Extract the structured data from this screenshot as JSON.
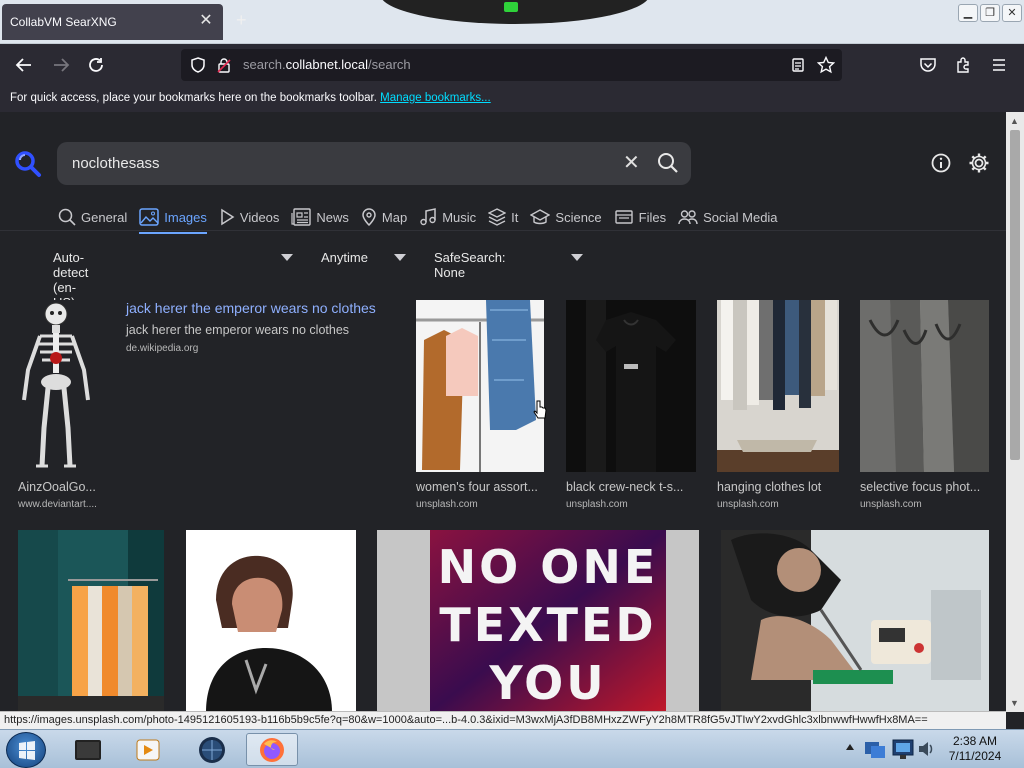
{
  "browser": {
    "tab_title": "CollabVM SearXNG",
    "tab_close_icon": "close-icon",
    "new_tab_label": "+",
    "url_prefix": "search.",
    "url_host": "collabnet.local",
    "url_path": "/search",
    "bookmarks_prompt": "For quick access, place your bookmarks here on the bookmarks toolbar.",
    "bookmarks_link": "Manage bookmarks..."
  },
  "search": {
    "query": "noclothesass"
  },
  "categories": [
    {
      "label": "General",
      "icon": "search-icon",
      "active": false
    },
    {
      "label": "Images",
      "icon": "image-icon",
      "active": true
    },
    {
      "label": "Videos",
      "icon": "play-icon",
      "active": false
    },
    {
      "label": "News",
      "icon": "newspaper-icon",
      "active": false
    },
    {
      "label": "Map",
      "icon": "map-pin-icon",
      "active": false
    },
    {
      "label": "Music",
      "icon": "music-icon",
      "active": false
    },
    {
      "label": "It",
      "icon": "layers-icon",
      "active": false
    },
    {
      "label": "Science",
      "icon": "graduation-cap-icon",
      "active": false
    },
    {
      "label": "Files",
      "icon": "folder-icon",
      "active": false
    },
    {
      "label": "Social Media",
      "icon": "people-icon",
      "active": false
    }
  ],
  "filters": {
    "language": "Auto-detect (en-US)",
    "time": "Anytime",
    "safesearch": "SafeSearch: None"
  },
  "detail": {
    "title": "jack herer the emperor wears no clothes",
    "description": "jack herer the emperor wears no clothes",
    "source": "de.wikipedia.org"
  },
  "results_row1": [
    {
      "title": "AinzOoalGo...",
      "source": "www.deviantart...."
    },
    {
      "title": "women's four assort...",
      "source": "unsplash.com"
    },
    {
      "title": "black crew-neck t-s...",
      "source": "unsplash.com"
    },
    {
      "title": "hanging clothes lot",
      "source": "unsplash.com"
    },
    {
      "title": "selective focus phot...",
      "source": "unsplash.com"
    }
  ],
  "meme_text": [
    "NO ONE",
    "TEXTED",
    "YOU"
  ],
  "status_url": "https://images.unsplash.com/photo-1495121605193-b116b5b9c5fe?q=80&w=1000&auto=...b-4.0.3&ixid=M3wxMjA3fDB8MHxzZWFyY2h8MTR8fG5vJTIwY2xvdGhlc3xlbnwwfHwwfHx8MA==",
  "taskbar": {
    "time": "2:38 AM",
    "date": "7/11/2024"
  }
}
